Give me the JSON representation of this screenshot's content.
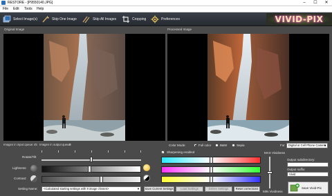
{
  "window": {
    "title": "RESTORE - [P9550140.JPG]",
    "min_glyph": "–",
    "max_glyph": "☐",
    "close_glyph": "✕"
  },
  "menu": [
    "File",
    "Edit",
    "Tools",
    "Help"
  ],
  "toolbar": {
    "buttons": [
      {
        "label": "Select Image(s)",
        "icon": "select-images-icon"
      },
      {
        "label": "Skip One Image",
        "icon": "skip-one-icon"
      },
      {
        "label": "Skip All Images",
        "icon": "skip-all-icon"
      },
      {
        "label": "Cropping",
        "icon": "cropping-icon"
      },
      {
        "label": "Preferences",
        "icon": "preferences-icon"
      }
    ],
    "logo": "VIVID-PIX"
  },
  "panels": {
    "original_label": "Original Image",
    "processed_label": "Processed Image"
  },
  "queue": {
    "input_label": "Images in input queue:",
    "input_count": "45",
    "output_label": "Images in output queue:",
    "output_count": "0"
  },
  "controls": {
    "rotate_label": "Rotate/Tilt",
    "lightness_label": "Lightness:",
    "contrast_label": "Contrast:",
    "setting_name_label": "Setting Name:",
    "setting_name_value": "<Calculated starting settings with 9 image chosen>",
    "save_settings": "Save Current Settings",
    "load_settings": "Load Settings",
    "delete_settings": "Delete Settings",
    "reset_corrections": "Reset corrections",
    "rotate_level": 0.5,
    "lightness_level": 0.48,
    "contrast_level": 0.6
  },
  "color_mode": {
    "label": "Color Mode:",
    "options": [
      "Full color",
      "B&W",
      "Sepia"
    ],
    "selected": "Full color",
    "for_label": "For",
    "for_value": "Digital or Cell Phone Camera",
    "sharpening_label": "Sharpening enabled",
    "sharpening_checked": true
  },
  "color_bars": [
    {
      "name": "cyan-red",
      "from": "#2ee8ff",
      "to": "#ff3030",
      "level": 0.5
    },
    {
      "name": "magenta-green",
      "from": "#ff33ff",
      "to": "#33ff33",
      "level": 0.5
    },
    {
      "name": "yellow-blue",
      "from": "#ffff33",
      "to": "#3333ff",
      "level": 0.5
    }
  ],
  "vividness": {
    "top_label": "MAX Vividness",
    "bottom_label": "MIN Vividness",
    "level": 0.5
  },
  "output": {
    "subdirectory_label": "Output subdirectory:",
    "subdirectory_value": "",
    "suffix_label": "Output suffix:",
    "suffix_value": "Vivid",
    "save_button": "Save Vivid-Pix"
  }
}
